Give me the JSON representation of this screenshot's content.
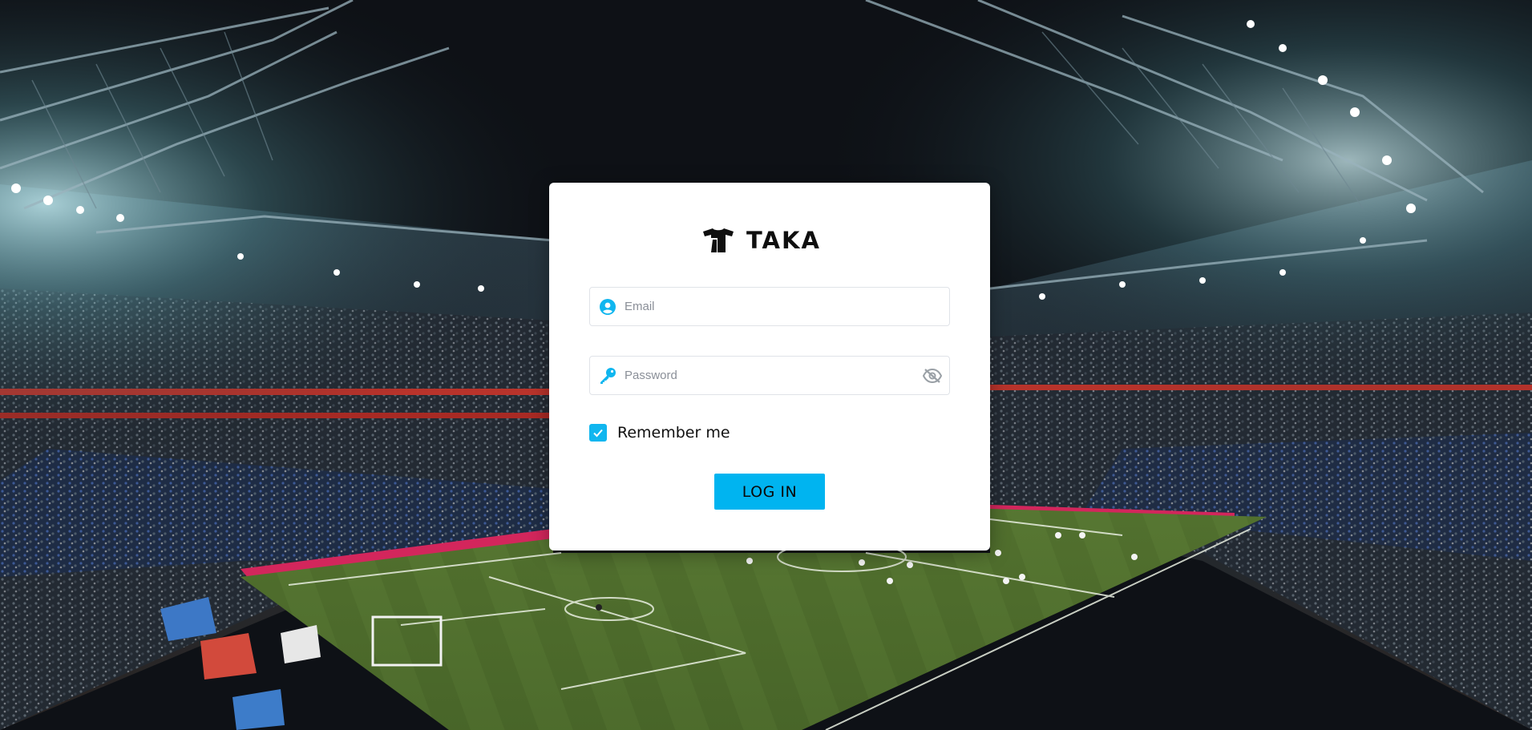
{
  "brand": {
    "name": "TAKA",
    "logo_icon": "jersey-logo-icon"
  },
  "form": {
    "email": {
      "placeholder": "Email",
      "value": "",
      "icon": "user-circle-icon"
    },
    "password": {
      "placeholder": "Password",
      "value": "",
      "icon": "key-icon",
      "toggle_icon": "eye-slash-icon"
    },
    "remember": {
      "label": "Remember me",
      "checked": true
    },
    "submit_label": "LOG IN"
  },
  "colors": {
    "accent": "#00b4f0",
    "card_background": "#ffffff",
    "sky": "#0e1116",
    "pitch": "#4e6b2c"
  }
}
